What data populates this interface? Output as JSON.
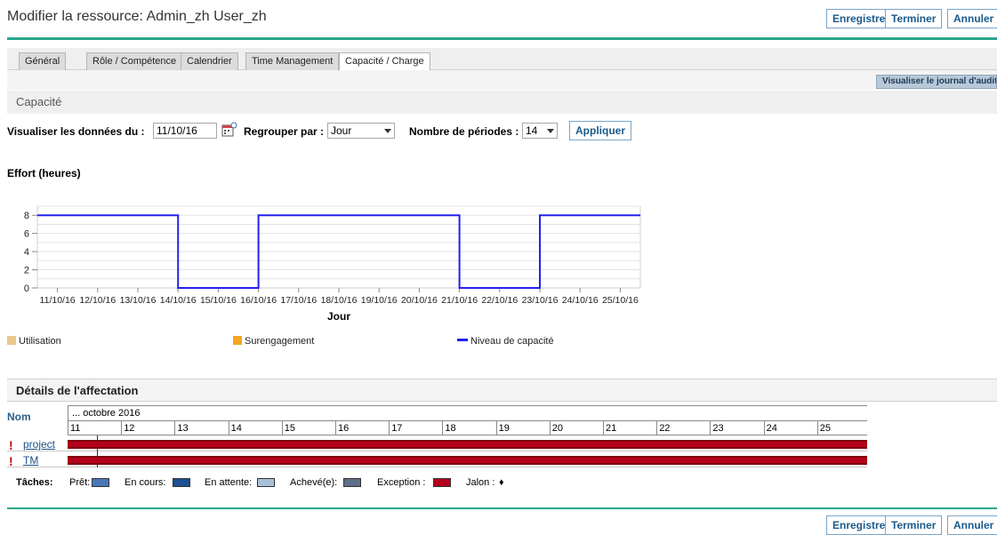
{
  "header": {
    "title": "Modifier la ressource: Admin_zh User_zh",
    "buttons": {
      "save": "Enregistrer",
      "finish": "Terminer",
      "cancel": "Annuler"
    }
  },
  "tabs": [
    {
      "label": "Général",
      "active": false
    },
    {
      "label": "Rôle / Compétence",
      "active": false
    },
    {
      "label": "Calendrier",
      "active": false
    },
    {
      "label": "Time Management",
      "active": false
    },
    {
      "label": "Capacité / Charge",
      "active": true
    }
  ],
  "audit_button": "Visualiser le journal d'audit",
  "capacity_section": {
    "title": "Capacité"
  },
  "filters": {
    "date_label": "Visualiser les données du :",
    "date_value": "11/10/16",
    "group_label": "Regrouper par :",
    "group_value": "Jour",
    "periods_label": "Nombre de périodes :",
    "periods_value": "14",
    "apply": "Appliquer"
  },
  "chart_data": {
    "type": "line",
    "title": "Effort (heures)",
    "xlabel": "Jour",
    "ylabel": "",
    "ylim": [
      0,
      9
    ],
    "yticks": [
      0,
      2,
      4,
      6,
      8
    ],
    "categories": [
      "11/10/16",
      "12/10/16",
      "13/10/16",
      "14/10/16",
      "15/10/16",
      "16/10/16",
      "17/10/16",
      "18/10/16",
      "19/10/16",
      "20/10/16",
      "21/10/16",
      "22/10/16",
      "23/10/16",
      "24/10/16",
      "25/10/16"
    ],
    "series": [
      {
        "name": "Niveau de capacité",
        "color": "#2222ee",
        "step": true,
        "values": [
          8,
          8,
          8,
          8,
          0,
          0,
          8,
          8,
          8,
          8,
          8,
          0,
          0,
          8,
          8
        ]
      }
    ],
    "legend": [
      {
        "name": "Utilisation",
        "color": "#e8c98a"
      },
      {
        "name": "Surengagement",
        "color": "#f5a623"
      },
      {
        "name": "Niveau de capacité",
        "color": "#2222ee"
      }
    ],
    "grid": true
  },
  "assignment_section": {
    "title": "Détails de l'affectation",
    "name_header": "Nom",
    "month": "... octobre 2016",
    "days": [
      "11",
      "12",
      "13",
      "14",
      "15",
      "16",
      "17",
      "18",
      "19",
      "20",
      "21",
      "22",
      "23",
      "24",
      "25"
    ],
    "rows": [
      {
        "name": "project",
        "status": "!"
      },
      {
        "name": "TM",
        "status": "!"
      }
    ],
    "bar_color": "#b5001b"
  },
  "task_legend": {
    "title": "Tâches:",
    "items": [
      {
        "label": "Prêt:",
        "color": "#4a78b5"
      },
      {
        "label": "En cours:",
        "color": "#1f4f95"
      },
      {
        "label": "En attente:",
        "color": "#a9c0dc"
      },
      {
        "label": "Achevé(e):",
        "color": "#5f6f88"
      },
      {
        "label": "Exception :",
        "color": "#b5001b"
      },
      {
        "label": "Jalon :",
        "glyph": "♦"
      }
    ]
  }
}
